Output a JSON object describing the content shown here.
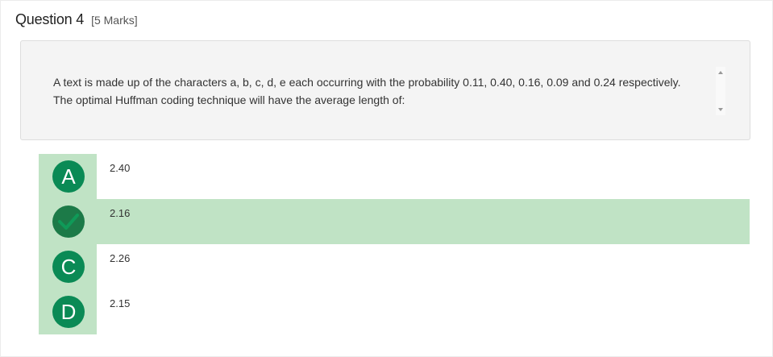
{
  "question": {
    "title": "Question 4",
    "marks": "[5 Marks]",
    "text": "A text is made up of the characters a, b, c, d, e each occurring with the probability 0.11, 0.40, 0.16, 0.09 and 0.24 respectively. The optimal Huffman coding technique will have the average length of:"
  },
  "options": [
    {
      "letter": "A",
      "value": "2.40",
      "correct": false
    },
    {
      "letter": "",
      "value": "2.16",
      "correct": true,
      "icon": "checkmark-icon"
    },
    {
      "letter": "C",
      "value": "2.26",
      "correct": false
    },
    {
      "letter": "D",
      "value": "2.15",
      "correct": false
    }
  ],
  "colors": {
    "badge": "#0a8a55",
    "correct_bg": "#c0e3c5",
    "check": "#1c7a48"
  }
}
